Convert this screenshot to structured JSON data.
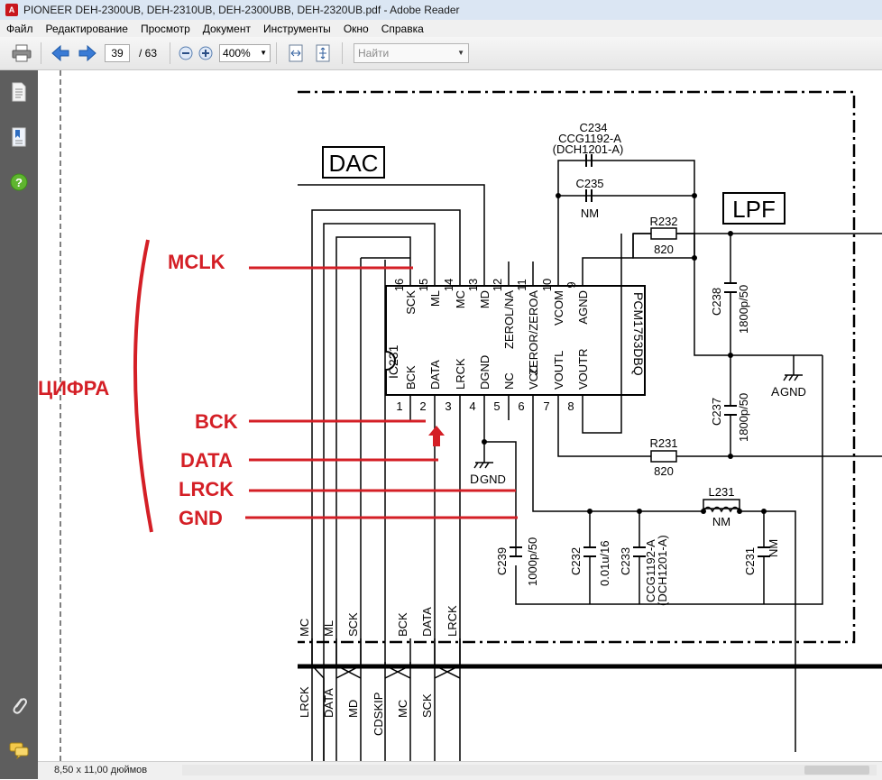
{
  "window": {
    "title": "PIONEER DEH-2300UB, DEH-2310UB, DEH-2300UBB, DEH-2320UB.pdf - Adobe Reader"
  },
  "menu": [
    "Файл",
    "Редактирование",
    "Просмотр",
    "Документ",
    "Инструменты",
    "Окно",
    "Справка"
  ],
  "toolbar": {
    "page_current": "39",
    "page_total": "/ 63",
    "zoom": "400%",
    "search_placeholder": "Найти"
  },
  "status": {
    "page_size": "8,50 x 11,00 дюймов"
  },
  "colors": {
    "annotation": "#d41f26",
    "sidebar": "#5e5e5e"
  },
  "schematic": {
    "block_dac": "DAC",
    "block_lpf": "LPF",
    "ic": {
      "ref": "IC231",
      "part": "PCM1753DBQ",
      "top_pin_numbers": [
        "16",
        "15",
        "14",
        "13",
        "12",
        "11",
        "10",
        "9"
      ],
      "top_pin_names": [
        "SCK",
        "ML",
        "MC",
        "MD",
        "ZEROL/NA",
        "ZEROR/ZEROA",
        "VCOM",
        "AGND"
      ],
      "bottom_pin_numbers": [
        "1",
        "2",
        "3",
        "4",
        "5",
        "6",
        "7",
        "8"
      ],
      "bottom_pin_names": [
        "BCK",
        "DATA",
        "LRCK",
        "DGND",
        "NC",
        "VCC",
        "VOUTL",
        "VOUTR"
      ]
    },
    "components": {
      "c234_a": "C234",
      "c234_b": "CCG1192-A",
      "c234_c": "(DCH1201-A)",
      "c235": "C235",
      "c235_val": "NM",
      "r232": "R232",
      "r232_val": "820",
      "r231": "R231",
      "r231_val": "820",
      "c238": "C238",
      "c238_val": "1800p/50",
      "c237": "C237",
      "c237_val": "1800p/50",
      "agnd_a": "A",
      "agnd_b": "GND",
      "dgnd_a": "D",
      "dgnd_b": "GND",
      "l231": "L231",
      "l231_val": "NM",
      "c239": "C239",
      "c239_val": "1000p/50",
      "c232": "C232",
      "c232_val": "0.01u/16",
      "c233": "C233",
      "c233_val_a": "CCG1192-A",
      "c233_val_b": "(DCH1201-A)",
      "c231": "C231",
      "c231_val": "NM"
    },
    "bus_upper_labels": [
      "MC",
      "ML",
      "SCK",
      "BCK",
      "DATA",
      "LRCK"
    ],
    "bus_lower_labels": [
      "LRCK",
      "DATA",
      "MD",
      "CDSKIP",
      "MC",
      "SCK"
    ]
  },
  "annotations": {
    "digit": "ЦИФРА",
    "mclk": "MCLK",
    "bck": "BCK",
    "data": "DATA",
    "lrck": "LRCK",
    "gnd": "GND"
  }
}
